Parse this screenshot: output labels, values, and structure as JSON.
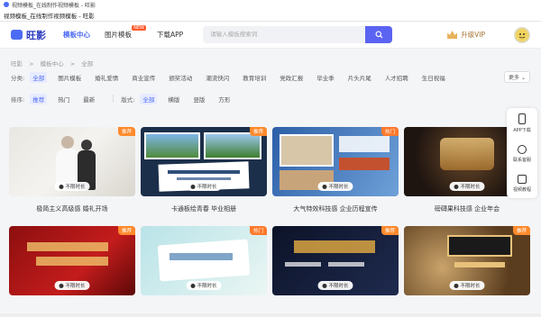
{
  "window": {
    "title": "视频模板_在线制作视频模板 - 旺影"
  },
  "tab": {
    "title": "视频模板_在线制作视频模板 - 旺影"
  },
  "header": {
    "brand": "旺影",
    "nav": [
      {
        "label": "模板中心",
        "active": true
      },
      {
        "label": "图片模板",
        "badge": "NEW"
      },
      {
        "label": "下载APP"
      }
    ],
    "search_placeholder": "请输入模板搜索词",
    "vip_label": "升级VIP"
  },
  "breadcrumb": [
    "旺影",
    ">",
    "模板中心",
    ">",
    "全部"
  ],
  "category": {
    "label": "分类:",
    "options": [
      "全部",
      "图片模板",
      "婚礼爱情",
      "商业宣传",
      "颁奖活动",
      "潮流快闪",
      "教育培训",
      "党政汇报",
      "毕业季",
      "片头片尾",
      "人才招聘",
      "生日祝福"
    ],
    "more": "更多"
  },
  "sort": {
    "label": "排序:",
    "options": [
      "推荐",
      "热门",
      "最新"
    ],
    "style_label": "版式:",
    "style_options": [
      "全部",
      "横版",
      "竖版",
      "方形"
    ]
  },
  "cards": [
    {
      "caption": "极简主义高级感 婚礼开场",
      "tag": "推荐",
      "duration": "不限时长"
    },
    {
      "caption": "卡通板绘青春 毕业相册",
      "tag": "推荐",
      "duration": "不限时长"
    },
    {
      "caption": "大气特效科技感 企业历程宣传",
      "tag": "热门",
      "duration": "不限时长"
    },
    {
      "caption": "磅礴果科技感 企业年会",
      "tag": "推荐",
      "duration": "不限时长"
    },
    {
      "caption": "",
      "tag": "推荐",
      "duration": "不限时长"
    },
    {
      "caption": "",
      "tag": "热门",
      "duration": "不限时长"
    },
    {
      "caption": "",
      "tag": "推荐",
      "duration": "不限时长"
    },
    {
      "caption": "",
      "tag": "推荐",
      "duration": "不限时长"
    }
  ],
  "sidebar": [
    {
      "label": "APP下载"
    },
    {
      "label": "联系客服"
    },
    {
      "label": "视频教程"
    }
  ],
  "colors": {
    "accent": "#4b6bf5",
    "hot_tag": "#ff7a2c",
    "search_button": "#5b63f2"
  }
}
